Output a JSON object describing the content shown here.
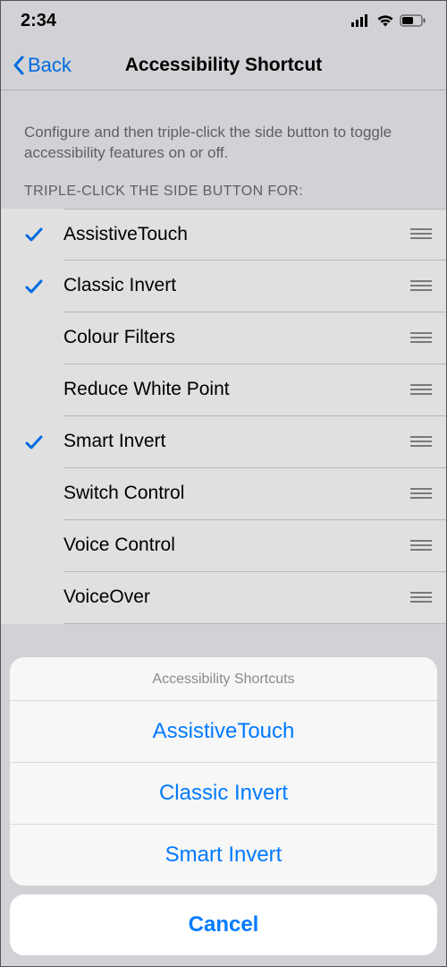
{
  "status": {
    "time": "2:34"
  },
  "nav": {
    "back": "Back",
    "title": "Accessibility Shortcut"
  },
  "description": "Configure and then triple-click the side button to toggle accessibility features on or off.",
  "sectionHeader": "TRIPLE-CLICK THE SIDE BUTTON FOR:",
  "rows": [
    {
      "label": "AssistiveTouch",
      "checked": true
    },
    {
      "label": "Classic Invert",
      "checked": true
    },
    {
      "label": "Colour Filters",
      "checked": false
    },
    {
      "label": "Reduce White Point",
      "checked": false
    },
    {
      "label": "Smart Invert",
      "checked": true
    },
    {
      "label": "Switch Control",
      "checked": false
    },
    {
      "label": "Voice Control",
      "checked": false
    },
    {
      "label": "VoiceOver",
      "checked": false
    }
  ],
  "sheet": {
    "title": "Accessibility Shortcuts",
    "items": [
      "AssistiveTouch",
      "Classic Invert",
      "Smart Invert"
    ],
    "cancel": "Cancel"
  },
  "colors": {
    "tint": "#007aff"
  }
}
